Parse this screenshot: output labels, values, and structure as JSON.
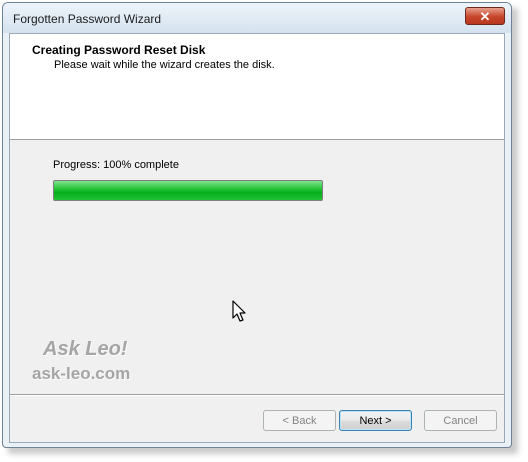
{
  "window": {
    "title": "Forgotten Password Wizard",
    "close_glyph": "✕"
  },
  "header": {
    "title": "Creating Password Reset Disk",
    "subtitle": "Please wait while the wizard creates the disk."
  },
  "progress": {
    "label": "Progress: 100% complete",
    "value": 100,
    "color": "#06b01c"
  },
  "watermark": {
    "line1": "Ask Leo!",
    "line2": "ask-leo.com"
  },
  "buttons": {
    "back": "< Back",
    "next": "Next >",
    "cancel": "Cancel"
  },
  "icons": {
    "close": "close-icon",
    "cursor": "mouse-pointer-icon"
  }
}
